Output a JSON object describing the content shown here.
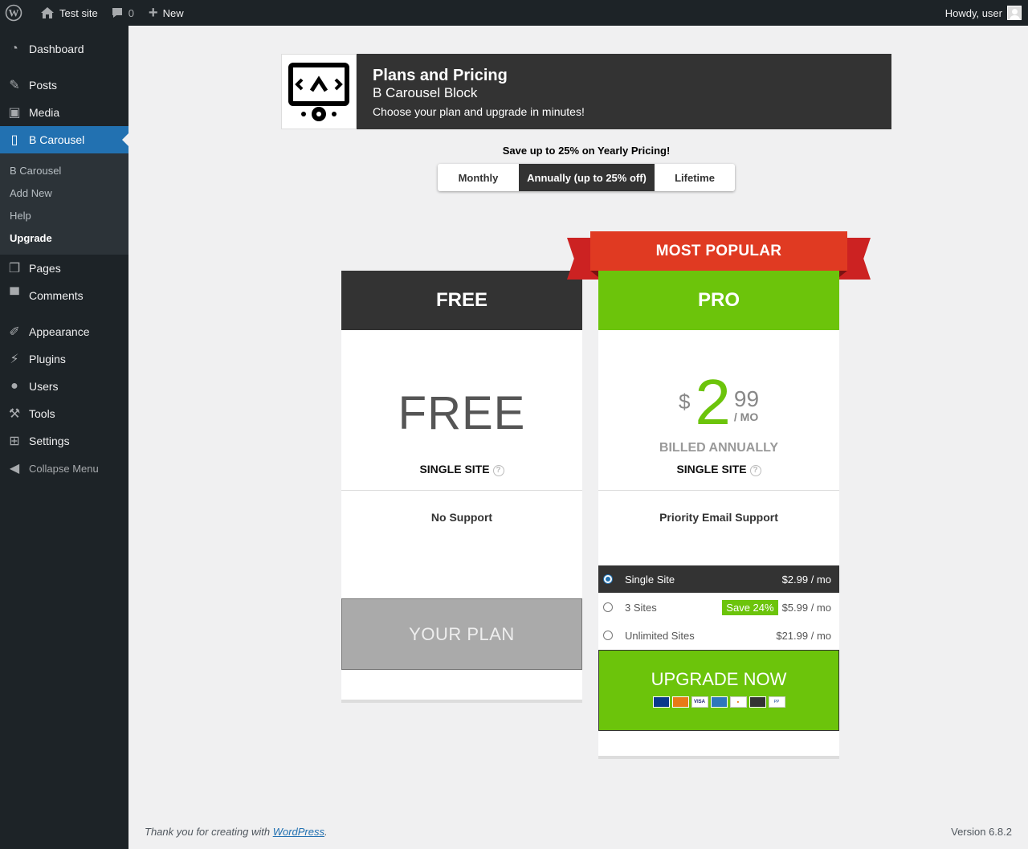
{
  "adminbar": {
    "site_name": "Test site",
    "comments_count": "0",
    "new_label": "New",
    "howdy": "Howdy, user"
  },
  "sidebar": {
    "items": [
      {
        "label": "Dashboard",
        "icon": "dashboard-icon"
      },
      {
        "label": "Posts",
        "icon": "pin-icon"
      },
      {
        "label": "Media",
        "icon": "media-icon"
      },
      {
        "label": "B Carousel",
        "icon": "carousel-icon"
      },
      {
        "label": "Pages",
        "icon": "pages-icon"
      },
      {
        "label": "Comments",
        "icon": "comment-icon"
      },
      {
        "label": "Appearance",
        "icon": "brush-icon"
      },
      {
        "label": "Plugins",
        "icon": "plugin-icon"
      },
      {
        "label": "Users",
        "icon": "users-icon"
      },
      {
        "label": "Tools",
        "icon": "wrench-icon"
      },
      {
        "label": "Settings",
        "icon": "settings-icon"
      }
    ],
    "submenu": [
      "B Carousel",
      "Add New",
      "Help",
      "Upgrade"
    ],
    "collapse_label": "Collapse Menu"
  },
  "header": {
    "title": "Plans and Pricing",
    "subtitle": "B Carousel Block",
    "description": "Choose your plan and upgrade in minutes!"
  },
  "billing": {
    "save_text": "Save up to 25% on Yearly Pricing!",
    "options": [
      "Monthly",
      "Annually (up to 25% off)",
      "Lifetime"
    ],
    "selected": "Annually (up to 25% off)"
  },
  "free_plan": {
    "name": "FREE",
    "price_label": "FREE",
    "site_label": "SINGLE SITE",
    "support": "No Support",
    "button": "YOUR PLAN"
  },
  "pro_plan": {
    "ribbon": "MOST POPULAR",
    "name": "PRO",
    "currency": "$",
    "amount": "2",
    "cents": "99",
    "per": "/ MO",
    "billed": "BILLED ANNUALLY",
    "site_label": "SINGLE SITE",
    "support": "Priority Email Support",
    "licenses": [
      {
        "label": "Single Site",
        "price": "$2.99 / mo",
        "badge": ""
      },
      {
        "label": "3 Sites",
        "price": "$5.99 / mo",
        "badge": "Save 24%"
      },
      {
        "label": "Unlimited Sites",
        "price": "$21.99 / mo",
        "badge": ""
      }
    ],
    "button": "UPGRADE NOW",
    "payments": [
      {
        "name": "Maestro",
        "color": "#0a3a8c"
      },
      {
        "name": "MasterCard",
        "color": "#e87a17"
      },
      {
        "name": "VISA",
        "color": "#1a1f71"
      },
      {
        "name": "AMEX",
        "color": "#2e77bb"
      },
      {
        "name": "DISCOVER",
        "color": "#f07f1b"
      },
      {
        "name": "BANK",
        "color": "#333333"
      },
      {
        "name": "PayPal",
        "color": "#ffffff"
      }
    ]
  },
  "footer": {
    "thanks_prefix": "Thank you for creating with",
    "wordpress_link": "WordPress",
    "version": "Version 6.8.2"
  },
  "colors": {
    "accent_green": "#6cc40b",
    "ribbon_red": "#e03a22",
    "wp_blue": "#2271b1",
    "dark": "#333333"
  }
}
